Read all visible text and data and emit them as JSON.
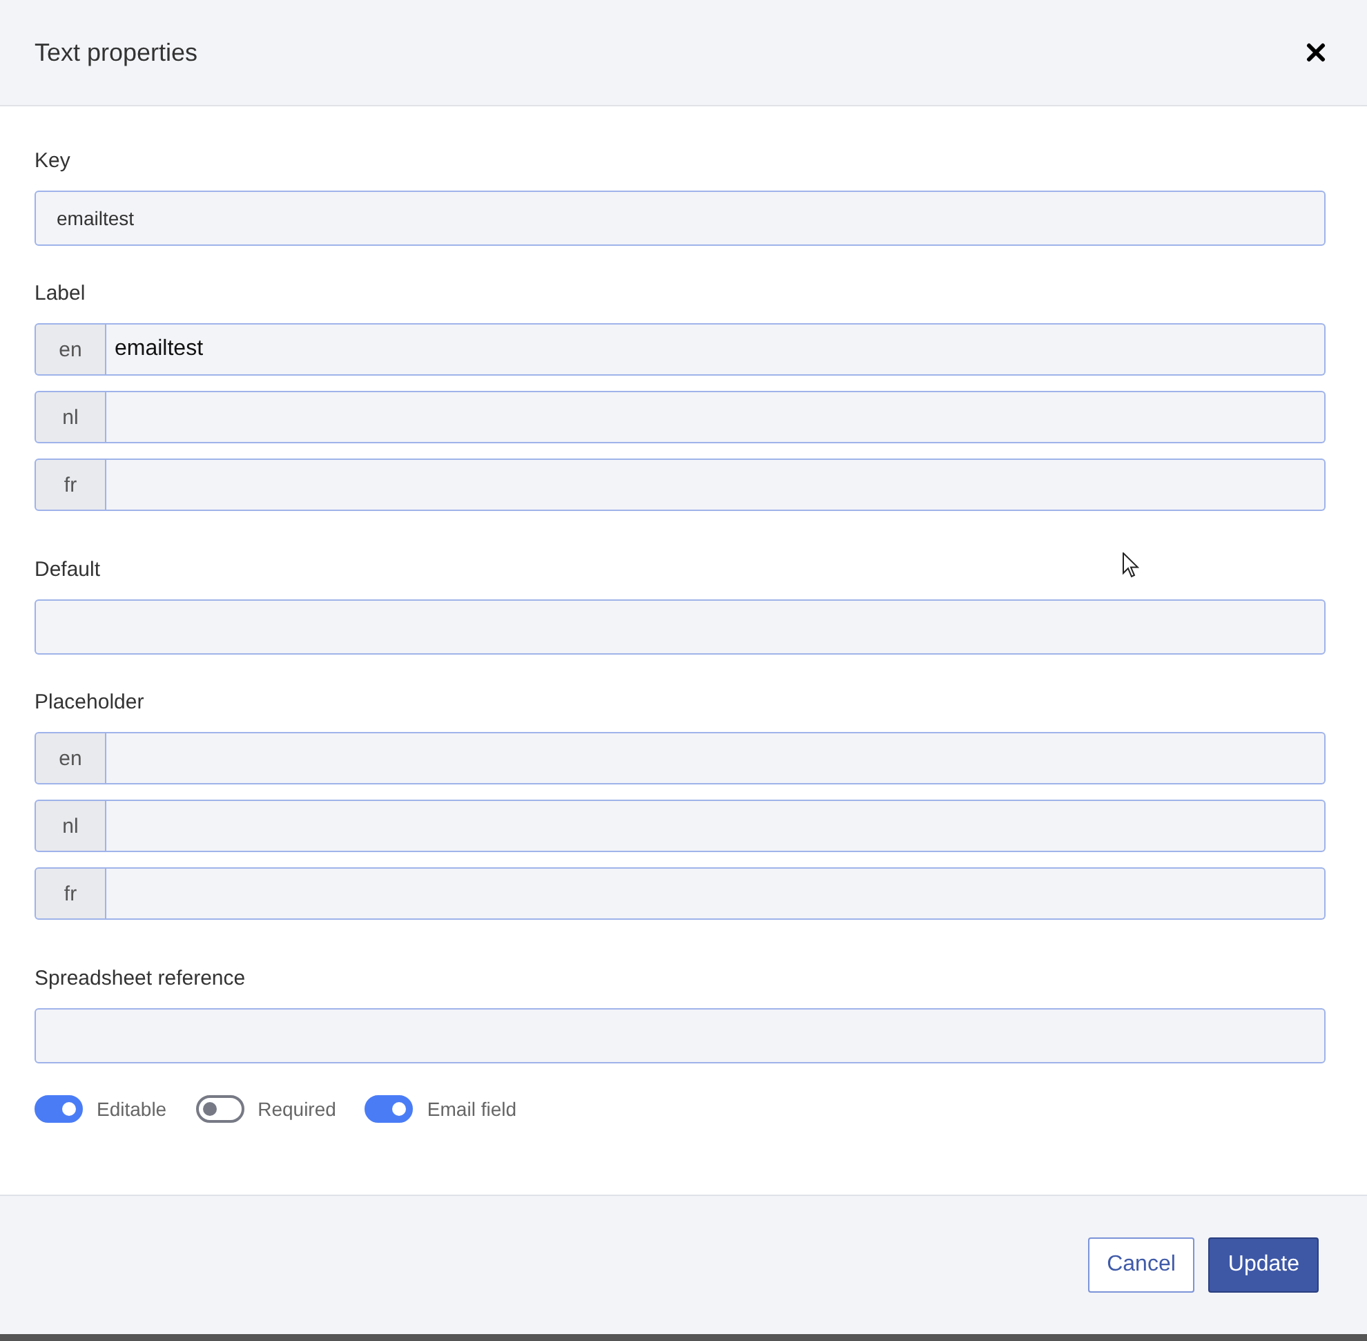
{
  "dialog": {
    "title": "Text properties"
  },
  "sections": [
    {
      "kind": "text",
      "label": "Key",
      "value": "emailtest"
    },
    {
      "kind": "lang",
      "label": "Label",
      "rows": [
        {
          "lang": "en",
          "value": "emailtest"
        },
        {
          "lang": "nl"
        },
        {
          "lang": "fr"
        }
      ]
    },
    {
      "kind": "text",
      "label": "Default"
    },
    {
      "kind": "lang",
      "label": "Placeholder",
      "rows": [
        {
          "lang": "en"
        },
        {
          "lang": "nl"
        },
        {
          "lang": "fr"
        }
      ]
    },
    {
      "kind": "text",
      "label": "Spreadsheet reference"
    }
  ],
  "toggles": [
    {
      "label": "Editable",
      "on": true
    },
    {
      "label": "Required",
      "on": false
    },
    {
      "label": "Email field",
      "on": true
    }
  ],
  "buttons": [
    {
      "label": "Cancel",
      "kind": "secondary"
    },
    {
      "label": "Update",
      "kind": "primary"
    }
  ]
}
